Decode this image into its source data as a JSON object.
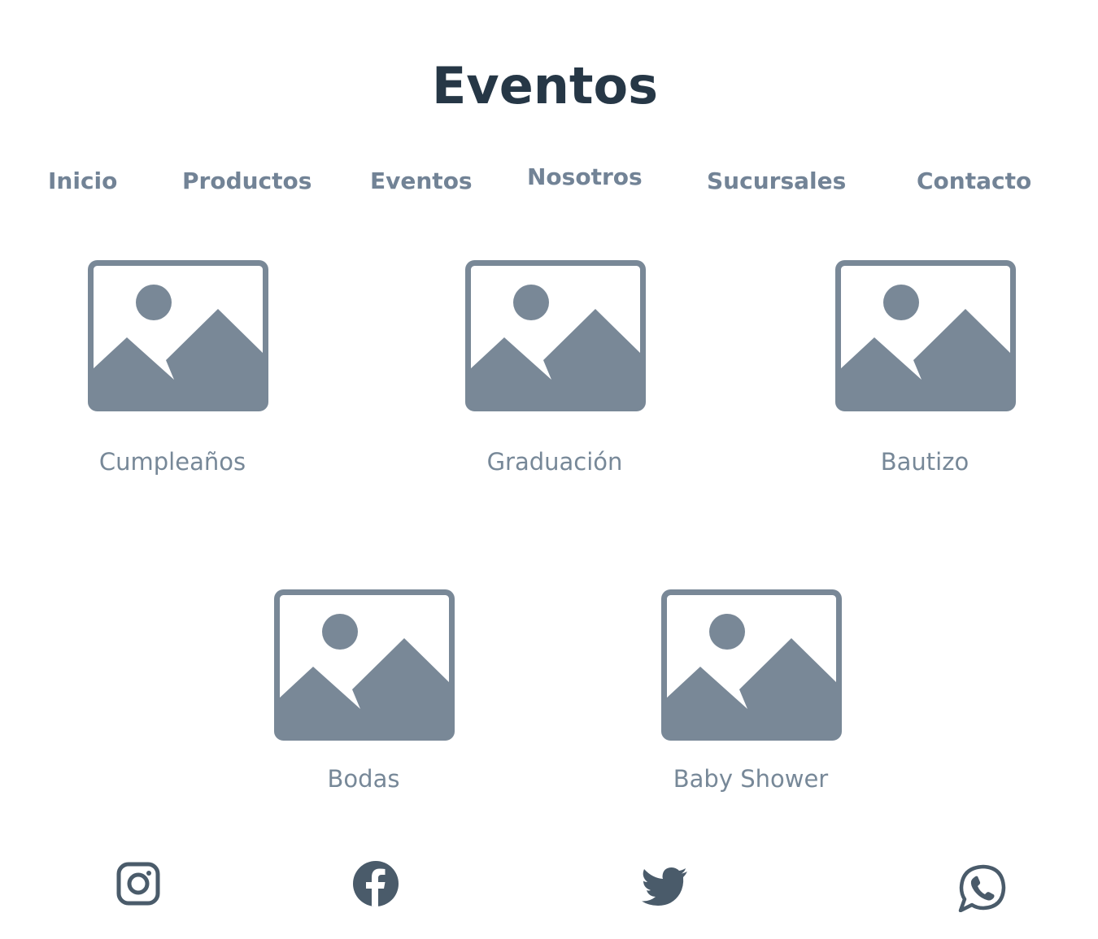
{
  "header": {
    "title": "Eventos"
  },
  "nav": {
    "items": [
      {
        "label": "Inicio"
      },
      {
        "label": "Productos"
      },
      {
        "label": "Eventos"
      },
      {
        "label": "Nosotros"
      },
      {
        "label": "Sucursales"
      },
      {
        "label": "Contacto"
      }
    ]
  },
  "events": [
    {
      "label": "Cumpleaños",
      "icon": "image-placeholder-icon"
    },
    {
      "label": "Graduación",
      "icon": "image-placeholder-icon"
    },
    {
      "label": "Bautizo",
      "icon": "image-placeholder-icon"
    },
    {
      "label": "Bodas",
      "icon": "image-placeholder-icon"
    },
    {
      "label": "Baby Shower",
      "icon": "image-placeholder-icon"
    }
  ],
  "social": [
    {
      "icon": "instagram-icon"
    },
    {
      "icon": "facebook-icon"
    },
    {
      "icon": "twitter-icon"
    },
    {
      "icon": "whatsapp-icon"
    }
  ],
  "colors": {
    "title": "#263746",
    "nav": "#728396",
    "placeholder": "#798897",
    "label": "#778898",
    "social": "#4a5b6a"
  }
}
